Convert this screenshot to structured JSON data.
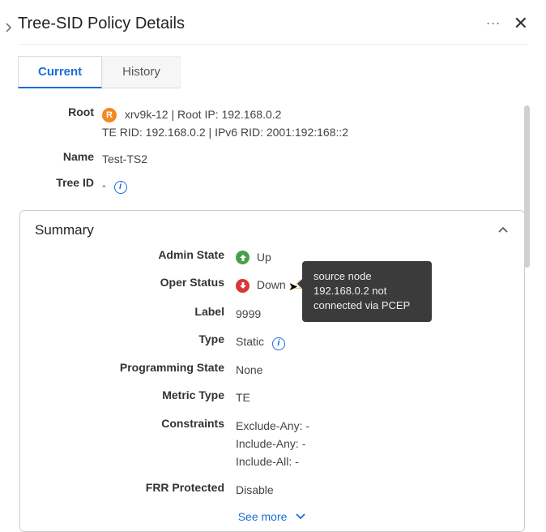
{
  "header": {
    "title": "Tree-SID Policy Details"
  },
  "tabs": {
    "current": "Current",
    "history": "History"
  },
  "root": {
    "label": "Root",
    "node_name": "xrv9k-12",
    "root_ip_label": "Root IP:",
    "root_ip": "192.168.0.2",
    "te_rid_label": "TE RID:",
    "te_rid": "192.168.0.2",
    "ipv6_rid_label": "IPv6 RID:",
    "ipv6_rid": "2001:192:168::2"
  },
  "name": {
    "label": "Name",
    "value": "Test-TS2"
  },
  "tree_id": {
    "label": "Tree ID",
    "value": "-"
  },
  "summary": {
    "title": "Summary",
    "admin_state": {
      "label": "Admin State",
      "value": "Up"
    },
    "oper_status": {
      "label": "Oper Status",
      "value": "Down"
    },
    "tooltip_text": "source node 192.168.0.2 not connected via PCEP",
    "label_field": {
      "label": "Label",
      "value": "9999"
    },
    "type": {
      "label": "Type",
      "value": "Static"
    },
    "prog_state": {
      "label": "Programming State",
      "value": "None"
    },
    "metric_type": {
      "label": "Metric Type",
      "value": "TE"
    },
    "constraints": {
      "label": "Constraints",
      "exclude_any": "Exclude-Any: -",
      "include_any": "Include-Any: -",
      "include_all": "Include-All: -"
    },
    "frr": {
      "label": "FRR Protected",
      "value": "Disable"
    },
    "see_more": "See more"
  }
}
